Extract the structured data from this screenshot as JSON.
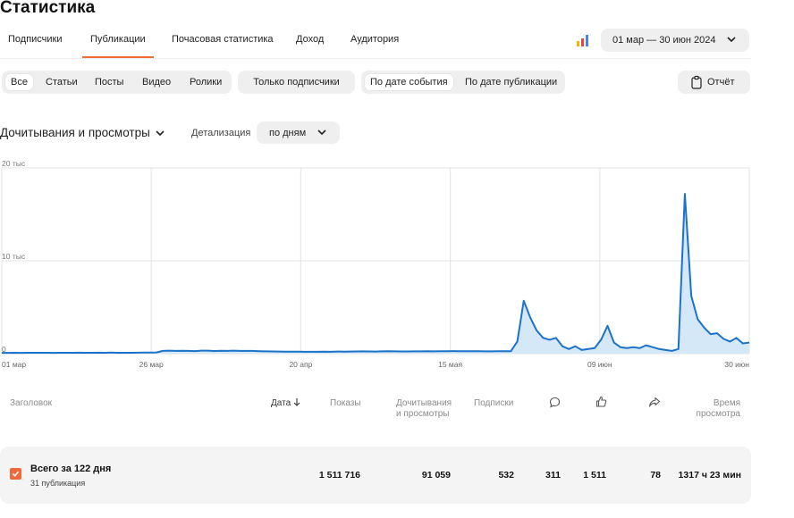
{
  "page": {
    "title": "Статистика"
  },
  "tabs": [
    {
      "label": "Подписчики"
    },
    {
      "label": "Публикации",
      "active": true
    },
    {
      "label": "Почасовая статистика"
    },
    {
      "label": "Доход"
    },
    {
      "label": "Аудитория"
    }
  ],
  "header": {
    "chart_type_icon": "bar-chart-icon",
    "date_range": "01 мар — 30 июн 2024"
  },
  "filters": {
    "content_types": [
      "Все",
      "Статьи",
      "Посты",
      "Видео",
      "Ролики"
    ],
    "content_type_selected": "Все",
    "subscribers_only": "Только подписчики",
    "date_modes": [
      "По дате события",
      "По дате публикации"
    ],
    "date_mode_selected": "По дате события",
    "report_label": "Отчёт"
  },
  "metric": {
    "title": "Дочитывания и просмотры",
    "detail_label": "Детализация",
    "detail_value": "по дням"
  },
  "colors": {
    "accent": "#ef6c38",
    "line": "#1a73c8",
    "fill": "#d5e8f7"
  },
  "chart_data": {
    "type": "area",
    "y_ticks": [
      "20 тыс",
      "10 тыс",
      "0"
    ],
    "ylim": [
      0,
      20000
    ],
    "x_tick_labels": [
      "01 мар",
      "26 мар",
      "20 апр",
      "15 мая",
      "09 июн",
      "30 июн"
    ],
    "grid": true,
    "series": [
      {
        "values": [
          80,
          80,
          90,
          80,
          90,
          90,
          100,
          90,
          80,
          100,
          90,
          90,
          110,
          100,
          100,
          110,
          90,
          120,
          100,
          100,
          100,
          110,
          120,
          120,
          130,
          300,
          320,
          300,
          310,
          300,
          280,
          330,
          320,
          290,
          310,
          300,
          320,
          300,
          300,
          300,
          270,
          250,
          240,
          230,
          220,
          220,
          220,
          210,
          210,
          200,
          220,
          210,
          230,
          220,
          230,
          240,
          250,
          240,
          230,
          250,
          260,
          250,
          240,
          240,
          250,
          250,
          260,
          250,
          260,
          270,
          280,
          270,
          270,
          260,
          260,
          250,
          250,
          260,
          260,
          270,
          1300,
          5700,
          3900,
          2500,
          1700,
          1500,
          1700,
          800,
          500,
          800,
          400,
          500,
          600,
          1500,
          3000,
          1200,
          700,
          600,
          700,
          600,
          900,
          700,
          500,
          400,
          300,
          500,
          17200,
          6200,
          3700,
          2800,
          2100,
          2200,
          1600,
          1300,
          1700,
          1100,
          1200
        ]
      }
    ]
  },
  "table": {
    "headers": {
      "title": "Заголовок",
      "date": "Дата",
      "impressions": "Показы",
      "reads_views": "Дочитывания и просмотры",
      "subscriptions": "Подписки",
      "comments_icon": "comment-icon",
      "likes_icon": "thumbs-up-icon",
      "shares_icon": "share-icon",
      "time": "Время просмотра"
    },
    "total": {
      "title": "Всего за 122 дня",
      "subtitle": "31 публикация",
      "impressions": "1 511 716",
      "reads_views": "91 059",
      "subscriptions": "532",
      "comments": "311",
      "likes": "1 511",
      "shares": "78",
      "time": "1317 ч 23 мин"
    }
  }
}
